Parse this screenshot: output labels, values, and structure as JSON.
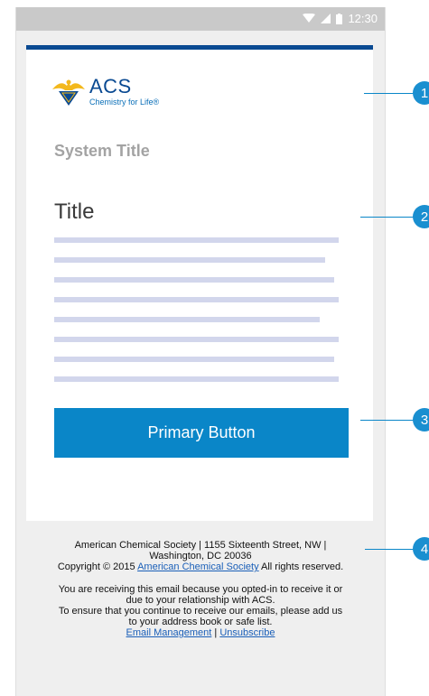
{
  "status_bar": {
    "time": "12:30"
  },
  "logo": {
    "name": "ACS",
    "tagline": "Chemistry for Life®"
  },
  "email": {
    "system_title": "System Title",
    "title": "Title",
    "primary_button_label": "Primary Button"
  },
  "footer": {
    "address_line1": "American Chemical Society | 1155 Sixteenth Street, NW |",
    "address_line2": "Washington, DC 20036",
    "copyright_prefix": "Copyright © 2015",
    "copyright_link": "American Chemical Society",
    "copyright_suffix": "All rights reserved.",
    "notice_line1": "You are receiving this email because you opted-in to receive it or",
    "notice_line2": "due to your relationship with ACS.",
    "notice_line3": "To ensure that you continue to receive our emails, please add us",
    "notice_line4": "to your address book or safe list.",
    "email_management_link": "Email Management",
    "separator": "|",
    "unsubscribe_link": "Unsubscribe"
  },
  "annotations": [
    "1",
    "2",
    "3",
    "4"
  ],
  "colors": {
    "brand_blue": "#0a4a92",
    "button_blue": "#0a86c8",
    "placeholder_line": "#d2d6ec",
    "marker_blue": "#1a8fd0"
  }
}
